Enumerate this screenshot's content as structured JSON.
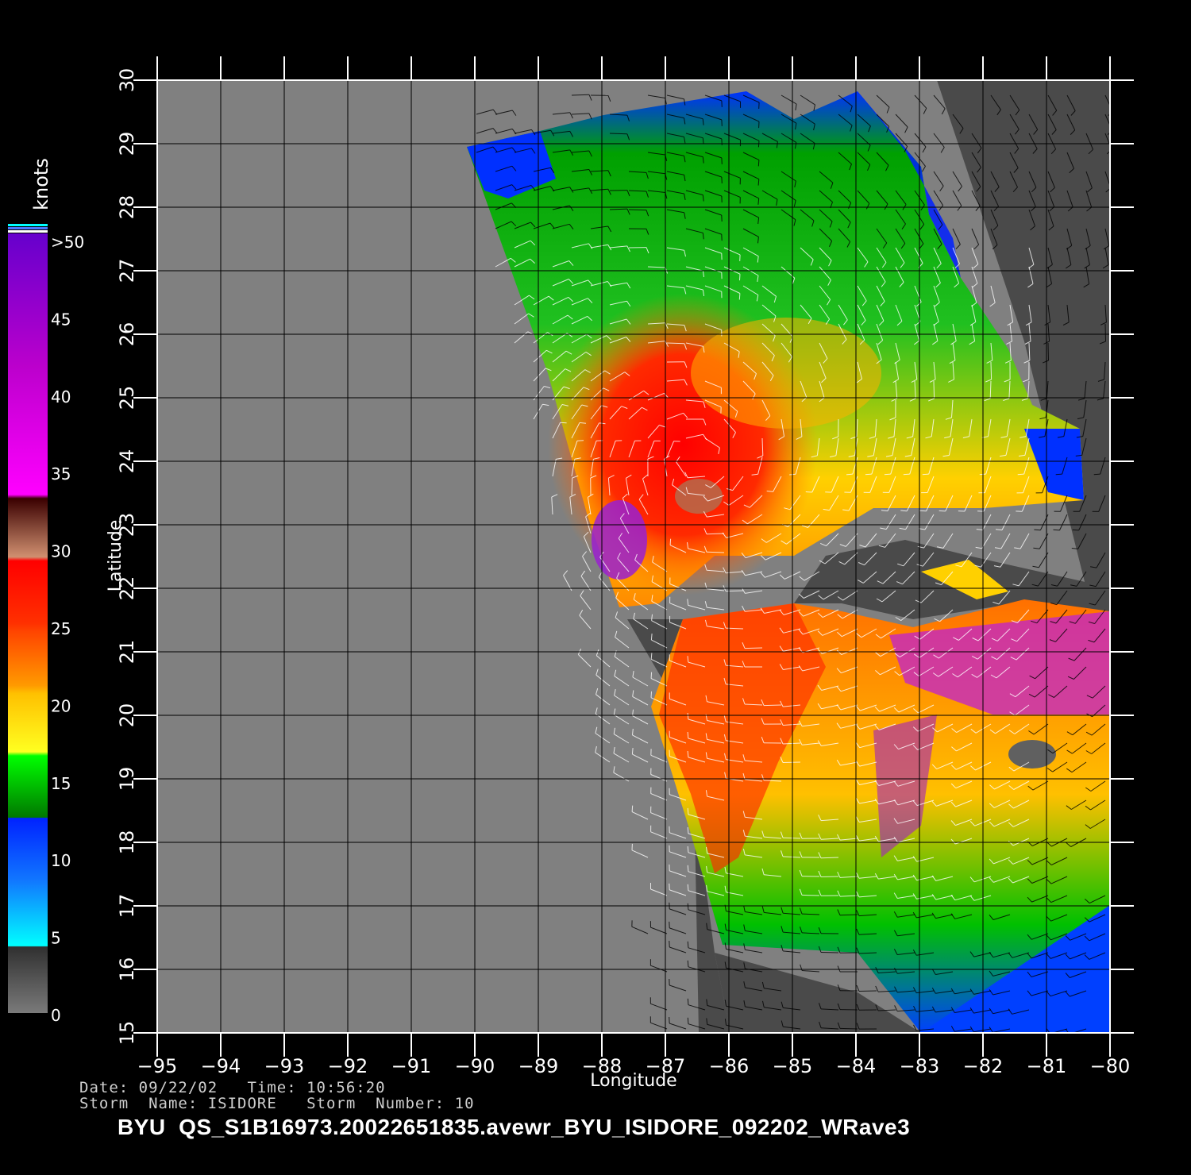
{
  "map": {
    "longitude_label": "Longitude",
    "latitude_label": "Latitude",
    "lon_range": [
      -95,
      -80
    ],
    "lat_range": [
      15,
      30
    ],
    "lon_ticks": [
      "−95",
      "−94",
      "−93",
      "−92",
      "−91",
      "−90",
      "−89",
      "−88",
      "−87",
      "−86",
      "−85",
      "−84",
      "−83",
      "−82",
      "−81",
      "−80"
    ],
    "lat_ticks": [
      "15",
      "16",
      "17",
      "18",
      "19",
      "20",
      "21",
      "22",
      "23",
      "24",
      "25",
      "26",
      "27",
      "28",
      "29",
      "30"
    ]
  },
  "colorbar": {
    "unit_label": "knots",
    "tick_labels": [
      "0",
      "5",
      "10",
      "15",
      "20",
      "25",
      "30",
      "35",
      "40",
      "45",
      ">50"
    ],
    "colors": {
      "0-5": [
        "#7a7a7a",
        "#303030"
      ],
      "5-10": [
        "#00ffff",
        "#1177ff"
      ],
      "10-15": [
        "#1177ff",
        "#0022ff"
      ],
      "15-20": [
        "#007800",
        "#00ff00"
      ],
      "20-25": [
        "#ffff20",
        "#ffc000"
      ],
      "25-30": [
        "#ff9a00",
        "#ff4400"
      ],
      "30-35": [
        "#ff3000",
        "#ff0000"
      ],
      "35-40": [
        "#d09070",
        "#3a0000"
      ],
      "40-45": [
        "#ff00ff",
        "#bb00cc"
      ],
      "45-50": [
        "#bb00cc",
        "#6600cc"
      ]
    }
  },
  "info": {
    "line1": "Date: 09/22/02   Time: 10:56:20",
    "line2": "Storm  Name: ISIDORE   Storm  Number: 10"
  },
  "title": "BYU  QS_S1B16973.20022651835.avewr_BYU_ISIDORE_092202_WRave3"
}
